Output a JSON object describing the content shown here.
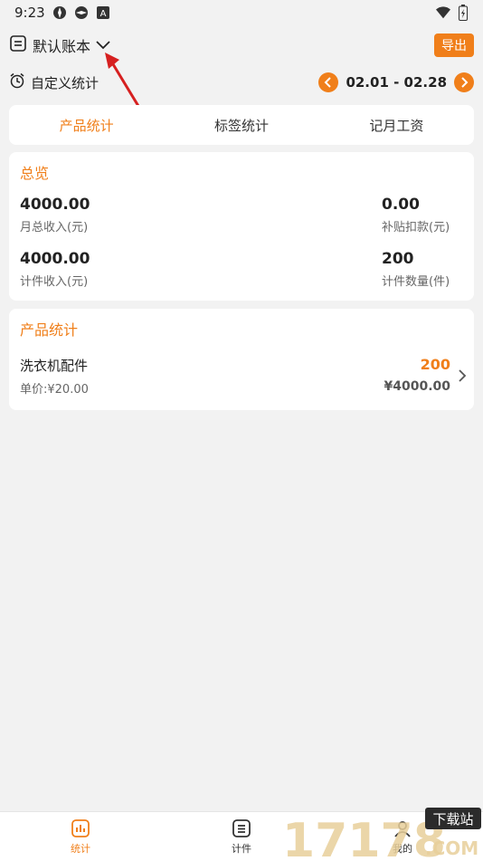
{
  "status_bar": {
    "time": "9:23",
    "badge": "A"
  },
  "header": {
    "book_name": "默认账本",
    "export_label": "导出"
  },
  "subheader": {
    "custom_stat_label": "自定义统计",
    "date_range": "02.01 - 02.28"
  },
  "tabs": [
    {
      "label": "产品统计",
      "active": true
    },
    {
      "label": "标签统计",
      "active": false
    },
    {
      "label": "记月工资",
      "active": false
    }
  ],
  "overview": {
    "title": "总览",
    "monthly_income": {
      "value": "4000.00",
      "label": "月总收入(元)"
    },
    "subsidy_deduction": {
      "value": "0.00",
      "label": "补贴扣款(元)"
    },
    "piece_income": {
      "value": "4000.00",
      "label": "计件收入(元)"
    },
    "piece_count": {
      "value": "200",
      "label": "计件数量(件)"
    }
  },
  "products": {
    "title": "产品统计",
    "items": [
      {
        "name": "洗衣机配件",
        "unit_price": "单价:¥20.00",
        "count": "200",
        "total": "¥4000.00"
      }
    ]
  },
  "bottom_nav": [
    {
      "label": "统计",
      "icon": "chart-icon",
      "active": true
    },
    {
      "label": "计件",
      "icon": "list-icon",
      "active": false
    },
    {
      "label": "我的",
      "icon": "user-icon",
      "active": false
    }
  ],
  "watermark": {
    "text": "17178",
    "badge": "下载站",
    "domain": ".COM"
  },
  "colors": {
    "accent": "#f07f1a",
    "background": "#f2f2f2",
    "annotation": "#d62020"
  }
}
